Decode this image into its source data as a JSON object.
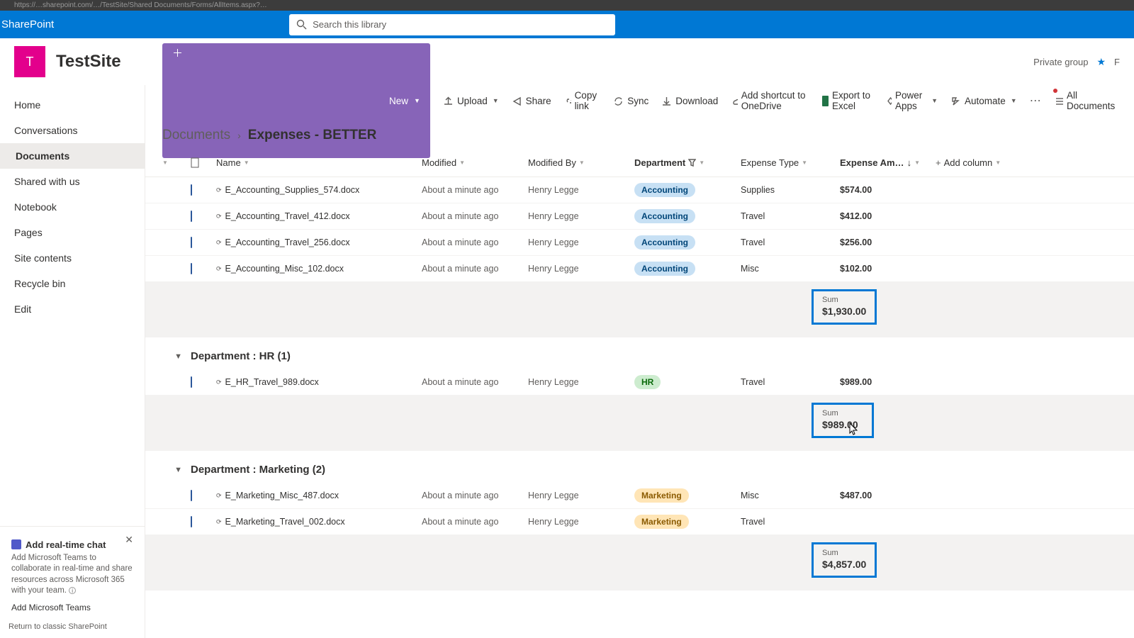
{
  "browser": {
    "url_fragment": "https://…sharepoint.com/…/TestSite/Shared Documents/Forms/AllItems.aspx?…"
  },
  "suite": {
    "app": "SharePoint"
  },
  "search": {
    "placeholder": "Search this library"
  },
  "site": {
    "logo_letter": "T",
    "title": "TestSite",
    "privacy": "Private group",
    "followers_prefix": "F"
  },
  "nav": {
    "items": [
      "Home",
      "Conversations",
      "Documents",
      "Shared with us",
      "Notebook",
      "Pages",
      "Site contents",
      "Recycle bin",
      "Edit"
    ],
    "active_index": 2
  },
  "chat_promo": {
    "title": "Add real-time chat",
    "desc": "Add Microsoft Teams to collaborate in real-time and share resources across Microsoft 365 with your team.",
    "link": "Add Microsoft Teams"
  },
  "classic_link": "Return to classic SharePoint",
  "commands": {
    "new": "New",
    "upload": "Upload",
    "share": "Share",
    "copylink": "Copy link",
    "sync": "Sync",
    "download": "Download",
    "shortcut": "Add shortcut to OneDrive",
    "export": "Export to Excel",
    "powerapps": "Power Apps",
    "automate": "Automate",
    "view": "All Documents"
  },
  "breadcrumb": {
    "root": "Documents",
    "current": "Expenses - BETTER"
  },
  "columns": {
    "name": "Name",
    "modified": "Modified",
    "modified_by": "Modified By",
    "department": "Department",
    "expense_type": "Expense Type",
    "amount": "Expense Am…",
    "add": "Add column"
  },
  "groups": [
    {
      "label": "",
      "rows": [
        {
          "name": "E_Accounting_Supplies_574.docx",
          "mod": "About a minute ago",
          "by": "Henry Legge",
          "dept": "Accounting",
          "dept_cls": "pill-acc",
          "etype": "Supplies",
          "amt": "$574.00"
        },
        {
          "name": "E_Accounting_Travel_412.docx",
          "mod": "About a minute ago",
          "by": "Henry Legge",
          "dept": "Accounting",
          "dept_cls": "pill-acc",
          "etype": "Travel",
          "amt": "$412.00"
        },
        {
          "name": "E_Accounting_Travel_256.docx",
          "mod": "About a minute ago",
          "by": "Henry Legge",
          "dept": "Accounting",
          "dept_cls": "pill-acc",
          "etype": "Travel",
          "amt": "$256.00"
        },
        {
          "name": "E_Accounting_Misc_102.docx",
          "mod": "About a minute ago",
          "by": "Henry Legge",
          "dept": "Accounting",
          "dept_cls": "pill-acc",
          "etype": "Misc",
          "amt": "$102.00"
        }
      ],
      "sum_label": "Sum",
      "sum": "$1,930.00"
    },
    {
      "label": "Department : HR (1)",
      "rows": [
        {
          "name": "E_HR_Travel_989.docx",
          "mod": "About a minute ago",
          "by": "Henry Legge",
          "dept": "HR",
          "dept_cls": "pill-hr",
          "etype": "Travel",
          "amt": "$989.00"
        }
      ],
      "sum_label": "Sum",
      "sum": "$989.00"
    },
    {
      "label": "Department : Marketing (2)",
      "rows": [
        {
          "name": "E_Marketing_Misc_487.docx",
          "mod": "About a minute ago",
          "by": "Henry Legge",
          "dept": "Marketing",
          "dept_cls": "pill-mkt",
          "etype": "Misc",
          "amt": "$487.00"
        },
        {
          "name": "E_Marketing_Travel_002.docx",
          "mod": "About a minute ago",
          "by": "Henry Legge",
          "dept": "Marketing",
          "dept_cls": "pill-mkt",
          "etype": "Travel",
          "amt": ""
        }
      ],
      "sum_label": "Sum",
      "sum": "$4,857.00"
    }
  ]
}
